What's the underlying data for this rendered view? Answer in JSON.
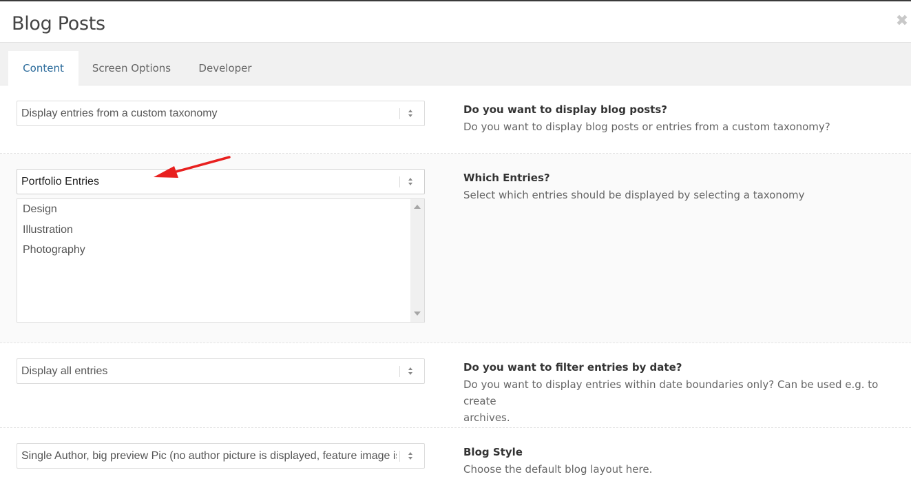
{
  "header": {
    "title": "Blog Posts",
    "close_glyph": "✖",
    "close_icon": "close-icon"
  },
  "tabs": [
    {
      "label": "Content",
      "active": true
    },
    {
      "label": "Screen Options",
      "active": false
    },
    {
      "label": "Developer",
      "active": false
    }
  ],
  "fields": {
    "display_source": {
      "value": "Display entries from a custom taxonomy",
      "heading": "Do you want to display blog posts?",
      "description": "Do you want to display blog posts or entries from a custom taxonomy?"
    },
    "which_entries": {
      "value": "Portfolio Entries",
      "heading": "Which Entries?",
      "description": "Select which entries should be displayed by selecting a taxonomy",
      "options": [
        "Design",
        "Illustration",
        "Photography"
      ]
    },
    "date_filter": {
      "value": "Display all entries",
      "heading": "Do you want to filter entries by date?",
      "description_line1": "Do you want to display entries within date boundaries only? Can be used e.g. to create",
      "description_line2": "archives."
    },
    "blog_style": {
      "value": "Single Author, big preview Pic (no author picture is displayed, feature image is big)",
      "heading": "Blog Style",
      "description": "Choose the default blog layout here."
    }
  },
  "colors": {
    "accent": "#2b6b9b",
    "annotation_arrow": "#e8201f",
    "tab_bar": "#f1f1f1"
  }
}
